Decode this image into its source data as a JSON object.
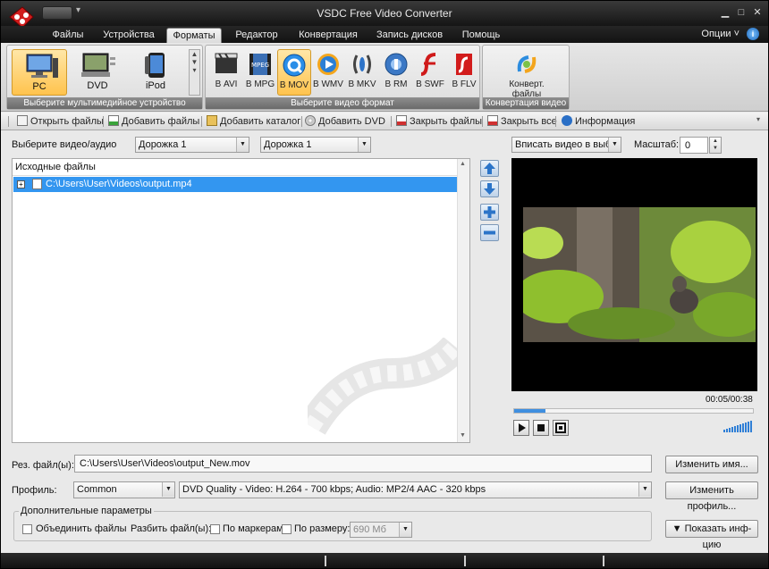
{
  "app": {
    "title": "VSDC Free Video Converter"
  },
  "menu": {
    "tabs": [
      {
        "label": "Файлы"
      },
      {
        "label": "Устройства"
      },
      {
        "label": "Форматы"
      },
      {
        "label": "Редактор"
      },
      {
        "label": "Конвертация"
      },
      {
        "label": "Запись дисков"
      },
      {
        "label": "Помощь"
      }
    ],
    "active_tab": "Форматы",
    "options_label": "Опции ˅",
    "help_icon": "i"
  },
  "ribbon": {
    "devices": {
      "items": [
        {
          "label": "PC",
          "icon": "pc-icon",
          "selected": true
        },
        {
          "label": "DVD",
          "icon": "dvd-player-icon",
          "selected": false
        },
        {
          "label": "iPod",
          "icon": "ipod-icon",
          "selected": false
        }
      ],
      "caption": "Выберите мультимедийное устройство"
    },
    "formats": {
      "items": [
        {
          "label": "В AVI",
          "icon": "avi-icon",
          "selected": false
        },
        {
          "label": "В MPG",
          "icon": "mpg-icon",
          "selected": false
        },
        {
          "label": "В MOV",
          "icon": "quicktime-icon",
          "selected": true
        },
        {
          "label": "В WMV",
          "icon": "wmv-icon",
          "selected": false
        },
        {
          "label": "В MKV",
          "icon": "mkv-icon",
          "selected": false
        },
        {
          "label": "В RM",
          "icon": "realmedia-icon",
          "selected": false
        },
        {
          "label": "В SWF",
          "icon": "flash-icon",
          "selected": false
        },
        {
          "label": "В FLV",
          "icon": "flv-icon",
          "selected": false
        }
      ],
      "caption": "Выберите видео формат"
    },
    "convert": {
      "label_line1": "Конверт.",
      "label_line2": "файлы",
      "caption": "Конвертация видео"
    }
  },
  "toolbar": {
    "items": [
      {
        "label": "Открыть файлы",
        "icon": "open-file-icon"
      },
      {
        "label": "Добавить файлы",
        "icon": "add-files-icon"
      },
      {
        "label": "Добавить каталог",
        "icon": "add-folder-icon"
      },
      {
        "label": "Добавить DVD",
        "icon": "add-dvd-icon"
      },
      {
        "label": "Закрыть файлы",
        "icon": "close-file-icon"
      },
      {
        "label": "Закрыть все",
        "icon": "close-all-icon"
      },
      {
        "label": "Информация",
        "icon": "info-icon"
      }
    ]
  },
  "main": {
    "select_label": "Выберите видео/аудио",
    "track1": "Дорожка 1",
    "track2": "Дорожка 1",
    "list_header": "Исходные файлы",
    "files": [
      {
        "path": "C:\\Users\\User\\Videos\\output.mp4",
        "selected": true
      }
    ]
  },
  "preview": {
    "fit_mode": "Вписать видео в выбр",
    "scale_label": "Масштаб:",
    "scale_value": "0",
    "timecode": "00:05/00:38",
    "progress_fraction": 0.13
  },
  "output": {
    "label": "Рез. файл(ы):",
    "path": "C:\\Users\\User\\Videos\\output_New.mov",
    "rename_button": "Изменить имя...",
    "profile_label": "Профиль:",
    "profile": "Common",
    "quality": "DVD Quality - Video: H.264 - 700 kbps; Audio: MP2/4 AAC - 320 kbps",
    "change_profile_button": "Изменить профиль..."
  },
  "extra": {
    "legend": "Дополнительные параметры",
    "merge_label": "Объединить файлы",
    "split_label": "Разбить файл(ы):",
    "by_markers_label": "По маркерам",
    "by_size_label": "По размеру:",
    "size_value": "690 Мб",
    "show_info_button": "▼ Показать инф-цию"
  }
}
